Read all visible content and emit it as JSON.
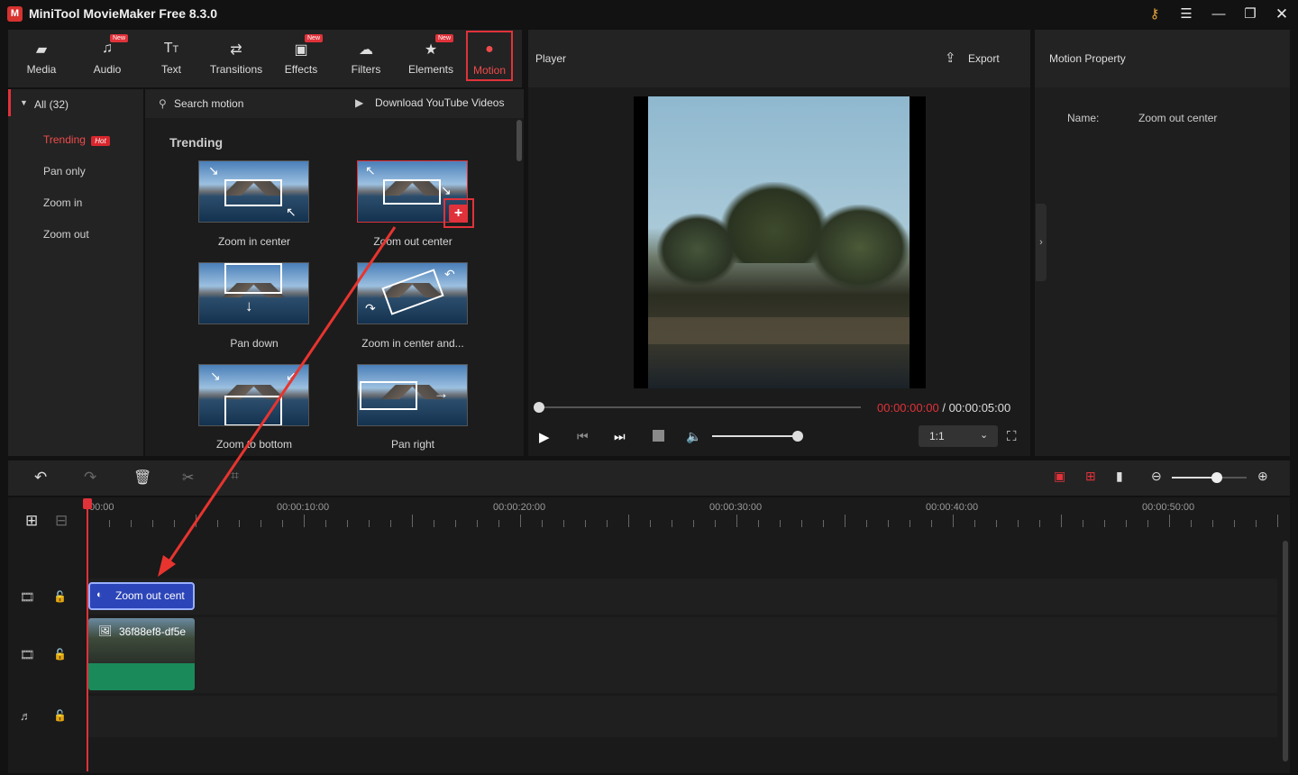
{
  "app": {
    "title": "MiniTool MovieMaker Free 8.3.0",
    "logo": "app-logo-icon"
  },
  "window_controls": [
    "key-icon",
    "menu-icon",
    "minimize-icon",
    "maximize-icon",
    "close-icon"
  ],
  "toolbar": {
    "items": [
      {
        "label": "Media",
        "icon": "media-icon",
        "new": false
      },
      {
        "label": "Audio",
        "icon": "audio-icon",
        "new": true
      },
      {
        "label": "Text",
        "icon": "text-icon",
        "new": false
      },
      {
        "label": "Transitions",
        "icon": "transitions-icon",
        "new": false
      },
      {
        "label": "Effects",
        "icon": "effects-icon",
        "new": true
      },
      {
        "label": "Filters",
        "icon": "filters-icon",
        "new": false
      },
      {
        "label": "Elements",
        "icon": "elements-icon",
        "new": true
      },
      {
        "label": "Motion",
        "icon": "motion-icon",
        "new": false,
        "active": true
      }
    ],
    "new_badge": "New"
  },
  "categories": {
    "all": "All (32)",
    "items": [
      "Trending",
      "Pan only",
      "Zoom in",
      "Zoom out"
    ],
    "hot_badge": "Hot",
    "active": "Trending"
  },
  "library": {
    "search_placeholder": "Search motion",
    "download_label": "Download YouTube Videos",
    "section": "Trending",
    "items": [
      "Zoom in center",
      "Zoom out center",
      "Pan down",
      "Zoom in center and...",
      "Zoom to bottom",
      "Pan right"
    ]
  },
  "player": {
    "title": "Player",
    "export_label": "Export",
    "current_time": "00:00:00:00",
    "separator": "/",
    "total_time": "00:00:05:00",
    "ratio": "1:1",
    "progress": 0,
    "volume": 1.0
  },
  "property": {
    "title": "Motion Property",
    "name_label": "Name:",
    "name_value": "Zoom out center"
  },
  "timeline": {
    "ruler": [
      "00:00",
      "00:00:10:00",
      "00:00:20:00",
      "00:00:30:00",
      "00:00:40:00",
      "00:00:50:00"
    ],
    "motion_clip": "Zoom out cent",
    "video_clip": "36f88ef8-df5e",
    "zoom_level": 0.6
  },
  "colors": {
    "accent": "#e0323a",
    "clip_blue": "#2c45b8",
    "clip_green": "#1a8a5a",
    "panel": "#232323"
  }
}
